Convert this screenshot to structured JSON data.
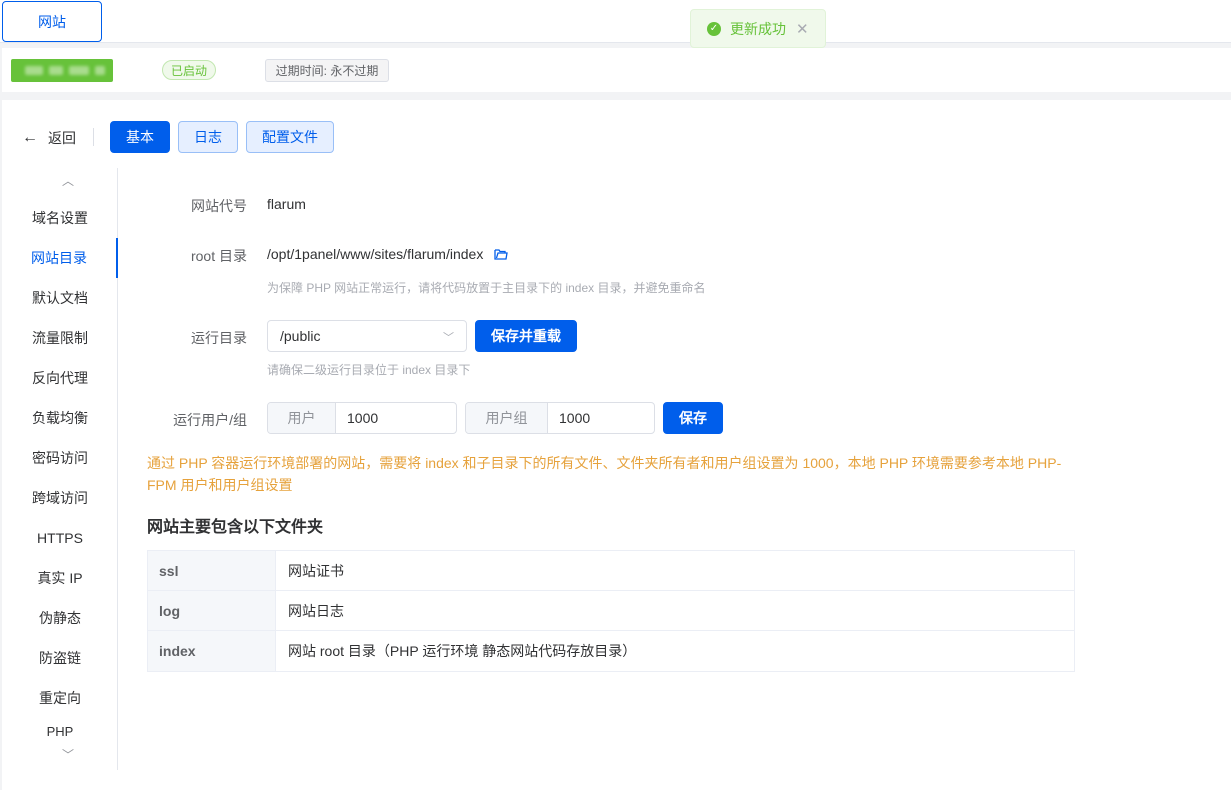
{
  "topbar": {
    "site_tab": "网站"
  },
  "toast": {
    "message": "更新成功"
  },
  "info": {
    "status": "已启动",
    "expire": "过期时间: 永不过期"
  },
  "toolbar": {
    "back": "返回",
    "tab_basic": "基本",
    "tab_log": "日志",
    "tab_config": "配置文件"
  },
  "sidebar": {
    "items": [
      {
        "label": "域名设置"
      },
      {
        "label": "网站目录"
      },
      {
        "label": "默认文档"
      },
      {
        "label": "流量限制"
      },
      {
        "label": "反向代理"
      },
      {
        "label": "负载均衡"
      },
      {
        "label": "密码访问"
      },
      {
        "label": "跨域访问"
      },
      {
        "label": "HTTPS"
      },
      {
        "label": "真实 IP"
      },
      {
        "label": "伪静态"
      },
      {
        "label": "防盗链"
      },
      {
        "label": "重定向"
      },
      {
        "label": "PHP"
      }
    ]
  },
  "form": {
    "code_label": "网站代号",
    "code_value": "flarum",
    "root_label": "root 目录",
    "root_value": "/opt/1panel/www/sites/flarum/index",
    "root_hint": "为保障 PHP 网站正常运行，请将代码放置于主目录下的 index 目录，并避免重命名",
    "run_label": "运行目录",
    "run_value": "/public",
    "run_button": "保存并重载",
    "run_hint": "请确保二级运行目录位于 index 目录下",
    "user_label": "运行用户/组",
    "user_prefix": "用户",
    "user_value": "1000",
    "group_prefix": "用户组",
    "group_value": "1000",
    "save_button": "保存"
  },
  "warning": "通过 PHP 容器运行环境部署的网站，需要将 index 和子目录下的所有文件、文件夹所有者和用户组设置为 1000，本地 PHP 环境需要参考本地 PHP-FPM 用户和用户组设置",
  "folders": {
    "title": "网站主要包含以下文件夹",
    "rows": [
      {
        "name": "ssl",
        "desc": "网站证书"
      },
      {
        "name": "log",
        "desc": "网站日志"
      },
      {
        "name": "index",
        "desc": "网站 root 目录（PHP 运行环境 静态网站代码存放目录）"
      }
    ]
  },
  "colors": {
    "primary": "#005eeb",
    "success": "#67c23a",
    "warning": "#e6a23c"
  }
}
